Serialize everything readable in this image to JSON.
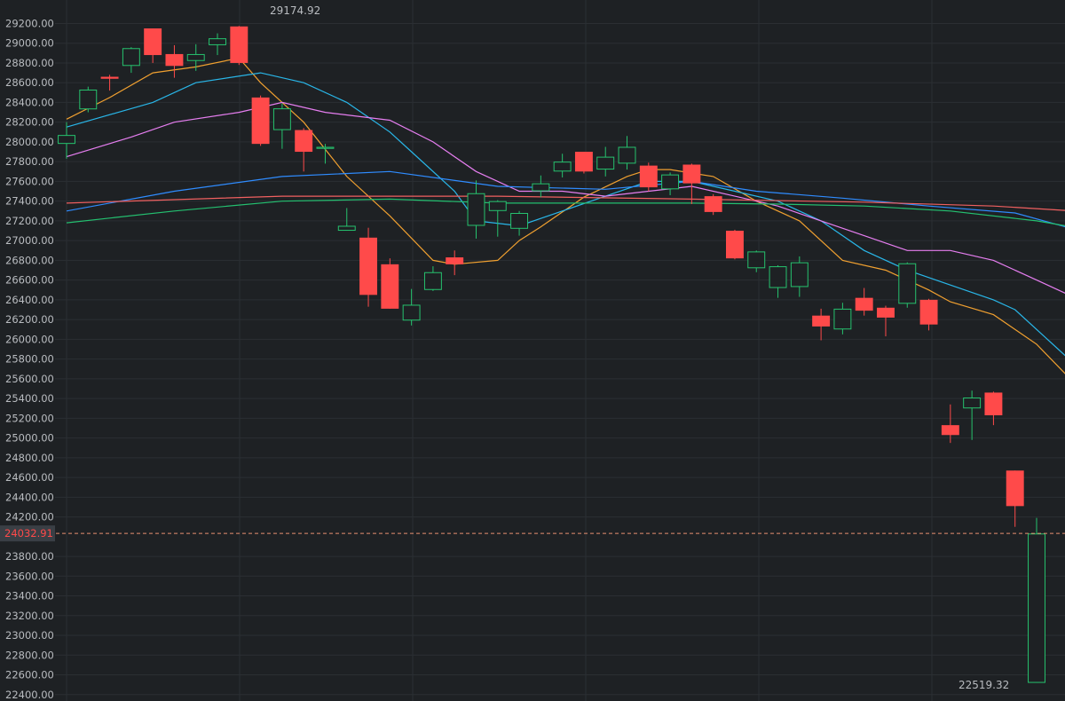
{
  "chart_data": {
    "type": "candlestick",
    "ylim": [
      22380,
      29330
    ],
    "y_ticks": [
      "29200.00",
      "29000.00",
      "28800.00",
      "28600.00",
      "28400.00",
      "28200.00",
      "28000.00",
      "27800.00",
      "27600.00",
      "27400.00",
      "27200.00",
      "27000.00",
      "26800.00",
      "26600.00",
      "26400.00",
      "26200.00",
      "26000.00",
      "25800.00",
      "25600.00",
      "25400.00",
      "25200.00",
      "25000.00",
      "24800.00",
      "24600.00",
      "24400.00",
      "24200.00",
      "23800.00",
      "23600.00",
      "23400.00",
      "23200.00",
      "23000.00",
      "22800.00",
      "22600.00",
      "22400.00"
    ],
    "grid": true,
    "colors": {
      "background": "#1e2124",
      "grid": "#2b2f33",
      "up": "#26c26e",
      "down": "#ff4a4a",
      "ma5": "#f0a030",
      "ma10": "#29b6e8",
      "ma20": "#e67ef0",
      "ma60": "#2f8cff",
      "ma120": "#24c070",
      "ma250": "#f06060",
      "current_line": "#e89070"
    },
    "max_label": "29174.92",
    "min_label": "22519.32",
    "current_price_label": "24032.91",
    "current_price": 24032.91,
    "candles": [
      {
        "o": 27980,
        "c": 28070,
        "h": 28200,
        "l": 27830
      },
      {
        "o": 28330,
        "c": 28530,
        "h": 28560,
        "l": 28300
      },
      {
        "o": 28660,
        "c": 28640,
        "h": 28680,
        "l": 28520
      },
      {
        "o": 28770,
        "c": 28950,
        "h": 28960,
        "l": 28700
      },
      {
        "o": 29150,
        "c": 28880,
        "h": 29150,
        "l": 28800
      },
      {
        "o": 28890,
        "c": 28770,
        "h": 28980,
        "l": 28650
      },
      {
        "o": 28820,
        "c": 28890,
        "h": 28990,
        "l": 28720
      },
      {
        "o": 28980,
        "c": 29050,
        "h": 29100,
        "l": 28880
      },
      {
        "o": 29170,
        "c": 28800,
        "h": 29175,
        "l": 28780
      },
      {
        "o": 28450,
        "c": 27980,
        "h": 28470,
        "l": 27960
      },
      {
        "o": 28120,
        "c": 28340,
        "h": 28390,
        "l": 27930
      },
      {
        "o": 28120,
        "c": 27900,
        "h": 28140,
        "l": 27700
      },
      {
        "o": 27930,
        "c": 27950,
        "h": 27980,
        "l": 27780
      },
      {
        "o": 27100,
        "c": 27150,
        "h": 27330,
        "l": 27100
      },
      {
        "o": 27030,
        "c": 26450,
        "h": 27130,
        "l": 26330
      },
      {
        "o": 26760,
        "c": 26310,
        "h": 26820,
        "l": 26310
      },
      {
        "o": 26190,
        "c": 26350,
        "h": 26510,
        "l": 26140
      },
      {
        "o": 26500,
        "c": 26680,
        "h": 26740,
        "l": 26490
      },
      {
        "o": 26830,
        "c": 26760,
        "h": 26900,
        "l": 26650
      },
      {
        "o": 27150,
        "c": 27480,
        "h": 27610,
        "l": 27020
      },
      {
        "o": 27300,
        "c": 27400,
        "h": 27410,
        "l": 27040
      },
      {
        "o": 27120,
        "c": 27280,
        "h": 27300,
        "l": 27050
      },
      {
        "o": 27500,
        "c": 27580,
        "h": 27660,
        "l": 27440
      },
      {
        "o": 27700,
        "c": 27800,
        "h": 27880,
        "l": 27640
      },
      {
        "o": 27900,
        "c": 27700,
        "h": 27900,
        "l": 27680
      },
      {
        "o": 27720,
        "c": 27850,
        "h": 27950,
        "l": 27650
      },
      {
        "o": 27780,
        "c": 27950,
        "h": 28060,
        "l": 27720
      },
      {
        "o": 27760,
        "c": 27540,
        "h": 27790,
        "l": 27500
      },
      {
        "o": 27520,
        "c": 27670,
        "h": 27690,
        "l": 27460
      },
      {
        "o": 27770,
        "c": 27580,
        "h": 27780,
        "l": 27370
      },
      {
        "o": 27450,
        "c": 27290,
        "h": 27470,
        "l": 27260
      },
      {
        "o": 27100,
        "c": 26820,
        "h": 27110,
        "l": 26810
      },
      {
        "o": 26720,
        "c": 26890,
        "h": 26900,
        "l": 26680
      },
      {
        "o": 26520,
        "c": 26740,
        "h": 26750,
        "l": 26420
      },
      {
        "o": 26530,
        "c": 26780,
        "h": 26840,
        "l": 26430
      },
      {
        "o": 26240,
        "c": 26130,
        "h": 26310,
        "l": 25990
      },
      {
        "o": 26100,
        "c": 26310,
        "h": 26370,
        "l": 26050
      },
      {
        "o": 26420,
        "c": 26290,
        "h": 26520,
        "l": 26240
      },
      {
        "o": 26320,
        "c": 26220,
        "h": 26340,
        "l": 26030
      },
      {
        "o": 26360,
        "c": 26770,
        "h": 26780,
        "l": 26320
      },
      {
        "o": 26400,
        "c": 26150,
        "h": 26410,
        "l": 26090
      },
      {
        "o": 25130,
        "c": 25030,
        "h": 25340,
        "l": 24950
      },
      {
        "o": 25300,
        "c": 25410,
        "h": 25480,
        "l": 24980
      },
      {
        "o": 25460,
        "c": 25230,
        "h": 25470,
        "l": 25130
      },
      {
        "o": 24670,
        "c": 24310,
        "h": 24670,
        "l": 24100
      },
      {
        "o": 22519,
        "c": 24032,
        "h": 24190,
        "l": 22519
      }
    ],
    "moving_averages": [
      {
        "color": "#f0a030",
        "points": [
          [
            0,
            28230
          ],
          [
            2,
            28450
          ],
          [
            4,
            28700
          ],
          [
            6,
            28760
          ],
          [
            8,
            28850
          ],
          [
            9,
            28600
          ],
          [
            11,
            28200
          ],
          [
            13,
            27650
          ],
          [
            15,
            27250
          ],
          [
            17,
            26800
          ],
          [
            18,
            26760
          ],
          [
            20,
            26800
          ],
          [
            21,
            27000
          ],
          [
            22,
            27140
          ],
          [
            24,
            27440
          ],
          [
            26,
            27650
          ],
          [
            27,
            27720
          ],
          [
            28,
            27720
          ],
          [
            30,
            27650
          ],
          [
            32,
            27400
          ],
          [
            34,
            27200
          ],
          [
            36,
            26800
          ],
          [
            38,
            26700
          ],
          [
            40,
            26500
          ],
          [
            41,
            26380
          ],
          [
            43,
            26250
          ],
          [
            44,
            26100
          ],
          [
            45,
            25950
          ],
          [
            47,
            25500
          ],
          [
            49,
            24700
          ]
        ]
      },
      {
        "color": "#29b6e8",
        "points": [
          [
            0,
            28150
          ],
          [
            4,
            28400
          ],
          [
            6,
            28600
          ],
          [
            9,
            28700
          ],
          [
            11,
            28600
          ],
          [
            13,
            28400
          ],
          [
            15,
            28100
          ],
          [
            16,
            27900
          ],
          [
            18,
            27500
          ],
          [
            19,
            27200
          ],
          [
            21,
            27150
          ],
          [
            23,
            27300
          ],
          [
            25,
            27450
          ],
          [
            27,
            27600
          ],
          [
            29,
            27600
          ],
          [
            31,
            27500
          ],
          [
            33,
            27400
          ],
          [
            35,
            27200
          ],
          [
            37,
            26900
          ],
          [
            39,
            26700
          ],
          [
            41,
            26550
          ],
          [
            43,
            26400
          ],
          [
            44,
            26300
          ],
          [
            46,
            25900
          ],
          [
            48,
            25500
          ],
          [
            49,
            25350
          ]
        ]
      },
      {
        "color": "#e67ef0",
        "points": [
          [
            0,
            27850
          ],
          [
            3,
            28050
          ],
          [
            5,
            28200
          ],
          [
            8,
            28300
          ],
          [
            10,
            28400
          ],
          [
            12,
            28300
          ],
          [
            15,
            28220
          ],
          [
            17,
            28000
          ],
          [
            19,
            27700
          ],
          [
            21,
            27500
          ],
          [
            23,
            27500
          ],
          [
            25,
            27450
          ],
          [
            27,
            27500
          ],
          [
            29,
            27550
          ],
          [
            31,
            27450
          ],
          [
            33,
            27350
          ],
          [
            35,
            27200
          ],
          [
            37,
            27050
          ],
          [
            39,
            26900
          ],
          [
            41,
            26900
          ],
          [
            43,
            26800
          ],
          [
            45,
            26600
          ],
          [
            47,
            26400
          ],
          [
            49,
            26050
          ]
        ]
      },
      {
        "color": "#2f8cff",
        "points": [
          [
            0,
            27300
          ],
          [
            5,
            27500
          ],
          [
            10,
            27650
          ],
          [
            15,
            27700
          ],
          [
            20,
            27550
          ],
          [
            25,
            27520
          ],
          [
            29,
            27600
          ],
          [
            32,
            27500
          ],
          [
            36,
            27430
          ],
          [
            40,
            27350
          ],
          [
            44,
            27280
          ],
          [
            47,
            27100
          ],
          [
            49,
            26850
          ]
        ]
      },
      {
        "color": "#24c070",
        "points": [
          [
            0,
            27180
          ],
          [
            5,
            27300
          ],
          [
            10,
            27400
          ],
          [
            15,
            27420
          ],
          [
            20,
            27380
          ],
          [
            25,
            27380
          ],
          [
            29,
            27380
          ],
          [
            33,
            27370
          ],
          [
            37,
            27350
          ],
          [
            41,
            27300
          ],
          [
            45,
            27200
          ],
          [
            49,
            27050
          ]
        ]
      },
      {
        "color": "#f06060",
        "points": [
          [
            0,
            27380
          ],
          [
            10,
            27450
          ],
          [
            20,
            27450
          ],
          [
            29,
            27420
          ],
          [
            37,
            27390
          ],
          [
            43,
            27350
          ],
          [
            49,
            27270
          ]
        ]
      }
    ]
  }
}
